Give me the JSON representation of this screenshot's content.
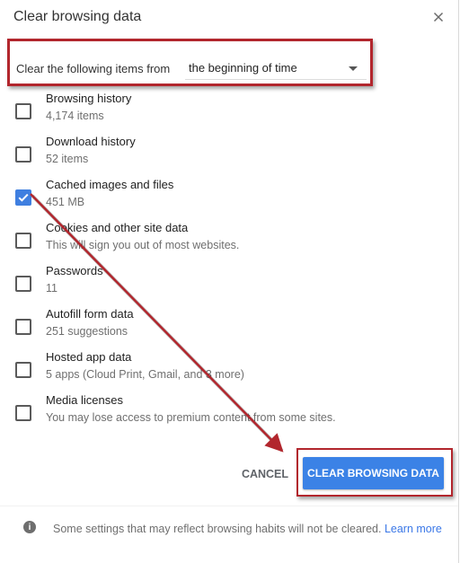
{
  "dialog": {
    "title": "Clear browsing data",
    "close_label": "×"
  },
  "time_range": {
    "label": "Clear the following items from",
    "selected": "the beginning of time"
  },
  "items": [
    {
      "label": "Browsing history",
      "sub": "4,174 items",
      "checked": false
    },
    {
      "label": "Download history",
      "sub": "52 items",
      "checked": false
    },
    {
      "label": "Cached images and files",
      "sub": "451 MB",
      "checked": true
    },
    {
      "label": "Cookies and other site data",
      "sub": "This will sign you out of most websites.",
      "checked": false
    },
    {
      "label": "Passwords",
      "sub": "11",
      "checked": false
    },
    {
      "label": "Autofill form data",
      "sub": "251 suggestions",
      "checked": false
    },
    {
      "label": "Hosted app data",
      "sub": "5 apps (Cloud Print, Gmail, and 3 more)",
      "checked": false
    },
    {
      "label": "Media licenses",
      "sub": "You may lose access to premium content from some sites.",
      "checked": false
    }
  ],
  "actions": {
    "cancel_label": "CANCEL",
    "clear_label": "CLEAR BROWSING DATA"
  },
  "footer": {
    "info_icon": "i",
    "text": "Some settings that may reflect browsing habits will not be cleared.",
    "link_label": "Learn more"
  },
  "colors": {
    "accent": "#3b82e6",
    "annotation": "#b2262d"
  },
  "icons": {
    "close": "close-icon",
    "dropdown": "chevron-down-icon",
    "checkbox": "checkbox-icon",
    "info": "info-icon",
    "annotation_arrow": "arrow-annotation"
  }
}
